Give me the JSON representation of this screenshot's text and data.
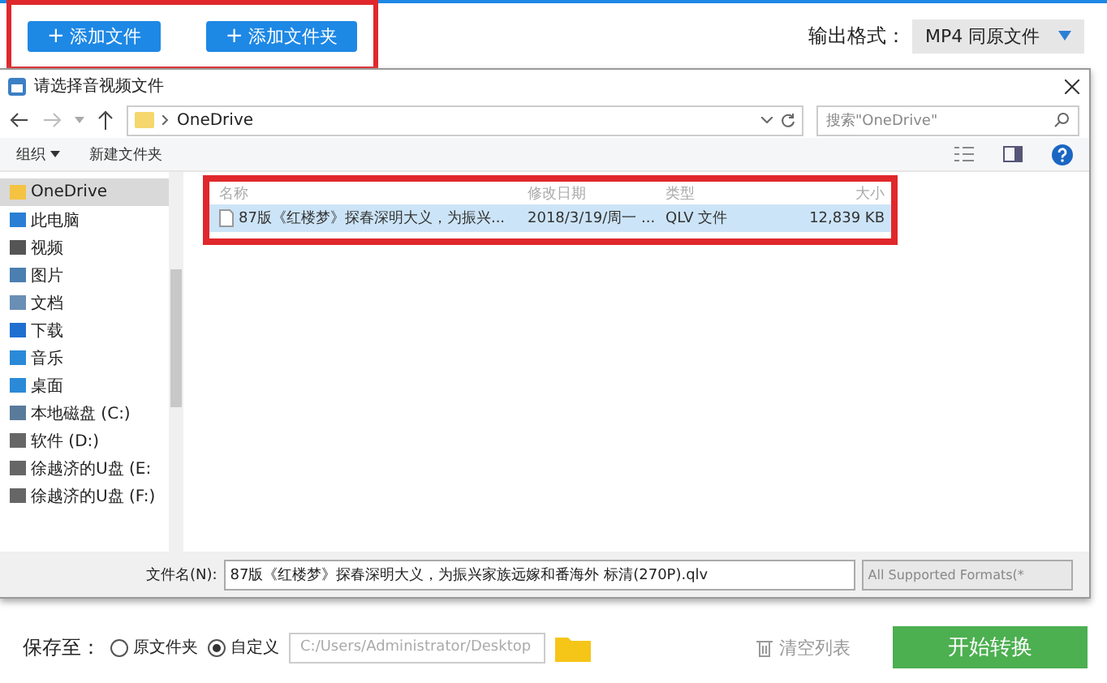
{
  "toolbar": {
    "buttons": [
      {
        "icon": "+",
        "label": "添加文件"
      },
      {
        "icon": "+",
        "label": "添加文件夹"
      }
    ],
    "format_label": "输出格式：",
    "format_value": "MP4  同原文件"
  },
  "dialog": {
    "title": "请选择音视频文件",
    "path": "OneDrive",
    "search": {
      "placeholder": "搜索\"OneDrive\""
    },
    "commands": [
      {
        "label": "组织",
        "dropdown": true
      },
      {
        "label": "新建文件夹",
        "dropdown": false
      }
    ],
    "sidebar": [
      {
        "label": "OneDrive",
        "kind": "folder",
        "selected": true
      },
      {
        "label": "此电脑",
        "kind": "pc",
        "selected": false
      },
      {
        "label": "视频",
        "kind": "video",
        "selected": false
      },
      {
        "label": "图片",
        "kind": "picture",
        "selected": false
      },
      {
        "label": "文档",
        "kind": "doc",
        "selected": false
      },
      {
        "label": "下载",
        "kind": "download",
        "selected": false
      },
      {
        "label": "音乐",
        "kind": "music",
        "selected": false
      },
      {
        "label": "桌面",
        "kind": "desktop",
        "selected": false
      },
      {
        "label": "本地磁盘 (C:)",
        "kind": "disk",
        "selected": false
      },
      {
        "label": "软件 (D:)",
        "kind": "drive",
        "selected": false
      },
      {
        "label": "徐越济的U盘 (E:",
        "kind": "drive",
        "selected": false
      },
      {
        "label": "徐越济的U盘 (F:)",
        "kind": "drive",
        "selected": false
      }
    ],
    "columns": [
      "名称",
      "修改日期",
      "类型",
      "大小"
    ],
    "rows": [
      {
        "name": "87版《红楼梦》探春深明大义，为振兴...",
        "date": "2018/3/19/周一 ...",
        "type": "QLV 文件",
        "size": "12,839 KB",
        "selected": true
      }
    ],
    "filename_label": "文件名(N):",
    "filename": "87版《红楼梦》探春深明大义，为振兴家族远嫁和番海外 标清(270P).qlv",
    "filter": "All Supported Formats(*"
  },
  "save": {
    "label": "保存至：",
    "options": [
      {
        "label": "原文件夹",
        "selected": false
      },
      {
        "label": "自定义",
        "selected": true
      }
    ],
    "path": "C:/Users/Administrator/Desktop",
    "clear": "清空列表",
    "start": "开始转换"
  }
}
